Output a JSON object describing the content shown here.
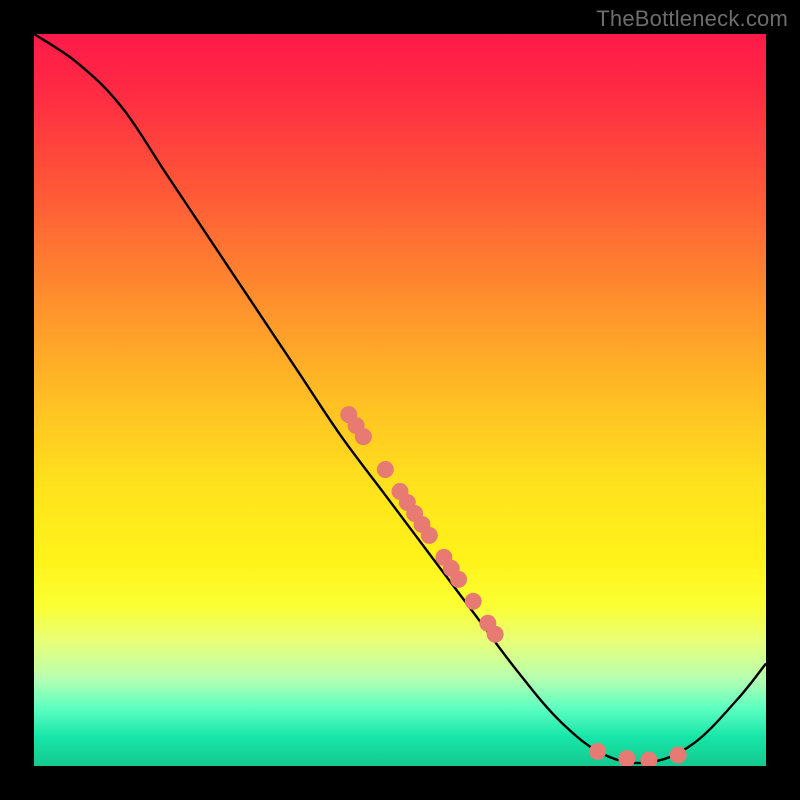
{
  "attribution": "TheBottleneck.com",
  "colors": {
    "curve_stroke": "#000000",
    "dot_fill": "#e77a72",
    "dot_stroke": "#c05a52"
  },
  "chart_data": {
    "type": "line",
    "title": "",
    "xlabel": "",
    "ylabel": "",
    "xlim": [
      0,
      100
    ],
    "ylim": [
      0,
      100
    ],
    "curve": [
      {
        "x": 0,
        "y": 100
      },
      {
        "x": 6,
        "y": 96
      },
      {
        "x": 12,
        "y": 90
      },
      {
        "x": 18,
        "y": 81
      },
      {
        "x": 24,
        "y": 72
      },
      {
        "x": 30,
        "y": 63
      },
      {
        "x": 36,
        "y": 54
      },
      {
        "x": 42,
        "y": 45
      },
      {
        "x": 48,
        "y": 37
      },
      {
        "x": 54,
        "y": 29
      },
      {
        "x": 60,
        "y": 21
      },
      {
        "x": 66,
        "y": 13
      },
      {
        "x": 72,
        "y": 6
      },
      {
        "x": 78,
        "y": 1.5
      },
      {
        "x": 84,
        "y": 0.5
      },
      {
        "x": 90,
        "y": 3
      },
      {
        "x": 96,
        "y": 9
      },
      {
        "x": 100,
        "y": 14
      }
    ],
    "dots": [
      {
        "x": 43,
        "y": 48
      },
      {
        "x": 44,
        "y": 46.5
      },
      {
        "x": 45,
        "y": 45
      },
      {
        "x": 48,
        "y": 40.5
      },
      {
        "x": 50,
        "y": 37.5
      },
      {
        "x": 51,
        "y": 36
      },
      {
        "x": 52,
        "y": 34.5
      },
      {
        "x": 53,
        "y": 33
      },
      {
        "x": 54,
        "y": 31.5
      },
      {
        "x": 56,
        "y": 28.5
      },
      {
        "x": 57,
        "y": 27
      },
      {
        "x": 58,
        "y": 25.5
      },
      {
        "x": 60,
        "y": 22.5
      },
      {
        "x": 62,
        "y": 19.5
      },
      {
        "x": 63,
        "y": 18
      },
      {
        "x": 77,
        "y": 2
      },
      {
        "x": 81,
        "y": 1
      },
      {
        "x": 84,
        "y": 0.8
      },
      {
        "x": 88,
        "y": 1.5
      }
    ]
  }
}
